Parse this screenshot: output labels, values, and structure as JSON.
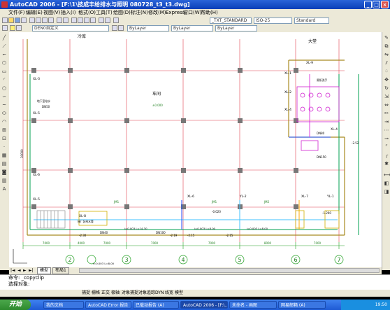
{
  "window": {
    "title": "AutoCAD 2006 - [F:\\1\\技成丰给排水与照明 080728_t3_t3.dwg]",
    "min": "_",
    "max": "□",
    "close": "×"
  },
  "menu": [
    "文件(F)",
    "编辑(E)",
    "视图(V)",
    "插入(I)",
    "格式(O)",
    "工具(T)",
    "绘图(D)",
    "标注(N)",
    "修改(M)",
    "Express",
    "窗口(W)",
    "帮助(H)"
  ],
  "toolbar": {
    "layer_combo": "DEN0自定义",
    "color_combo": "ByLayer",
    "linetype_combo": "ByLayer",
    "lineweight_combo": "ByLayer",
    "textstyle_combo": "_TXT_STANDARD",
    "dimstyle_combo": "ISO-25",
    "tablestyle_combo": "Standard"
  },
  "drawing": {
    "room_top": "冷库",
    "room_main": "车间",
    "room_right": "大堂",
    "level_main": "±0.000",
    "axis_bottom": [
      "2",
      "3",
      "4",
      "5",
      "6",
      "7"
    ],
    "dims_bottom": [
      "7000",
      "4000",
      "7000",
      "7000",
      "7000",
      "8000",
      "7000",
      "8000"
    ],
    "dim_left": [
      "30000",
      "8400",
      "1000"
    ],
    "risers": [
      "XL-3",
      "XL-5",
      "XL-6",
      "XL-5",
      "XL-1",
      "XL-2",
      "XL-4",
      "XL-4",
      "XL-6",
      "XL-7",
      "XL-8",
      "XL-9",
      "YL-1",
      "YL-2"
    ],
    "pipe_labels": [
      "DN40",
      "DN50",
      "DN100",
      "DN80",
      "DN150"
    ],
    "slope_labels": [
      "i=0.003 L=14.30",
      "i=0.003 L=8.00",
      "i=0.003 L=8.00",
      "i=0.003 L=8.00"
    ],
    "elevations": [
      "-2.30",
      "-2.15",
      "-2.15",
      "-2.19",
      "-2.52",
      "-1.200",
      "-0.020",
      "-0.020",
      "-2.52"
    ],
    "notes": [
      "地下室给水",
      "接厂区给水管",
      "厕所洗手"
    ],
    "scale_labels": [
      "JM1",
      "JM1",
      "JM2"
    ]
  },
  "tabs": [
    "模型",
    "布局1"
  ],
  "command": {
    "line1": "命令: _copyclip",
    "line2": "选择对象:",
    "prompt": "命令:"
  },
  "status": [
    "捕捉",
    "栅格",
    "正交",
    "极轴",
    "对象捕捉",
    "对象追踪",
    "DYN",
    "线宽",
    "模型"
  ],
  "taskbar": {
    "start": "开始",
    "tasks": [
      "我的文档",
      "AutoCAD Error 报告",
      "已载动报告 (A)",
      "AutoCAD 2006 - [F:\\...",
      "未命名 - 画图",
      "网易邮箱 (A)"
    ],
    "clock": "19:50"
  }
}
